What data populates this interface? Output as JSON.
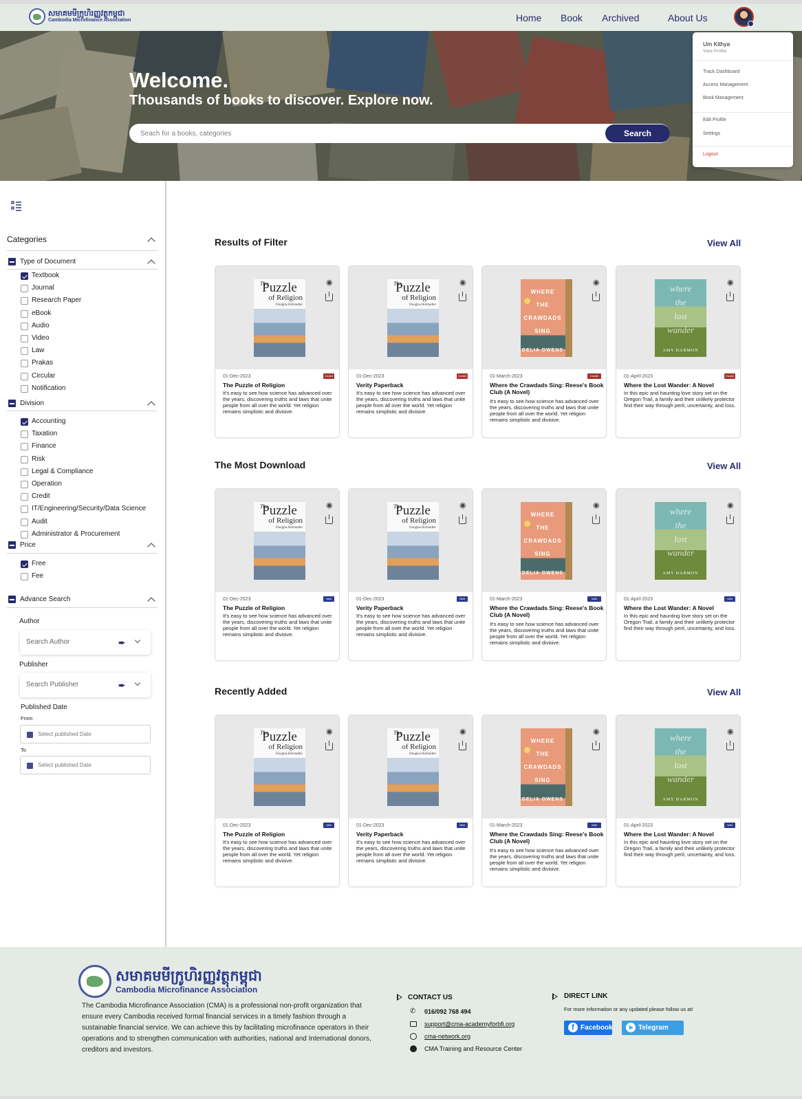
{
  "nav": {
    "logo_khmer": "សមាគមមីក្រូហិរញ្ញវត្ថុកម្ពុជា",
    "logo_english": "Cambodia Microfinance Association",
    "links": [
      "Home",
      "Book",
      "Archived",
      "About Us"
    ]
  },
  "hero": {
    "welcome": "Welcome.",
    "subtitle": "Thousands of books to discover. Explore now.",
    "search_placeholder": "Seach for a books, categories",
    "search_button": "Search"
  },
  "user_menu": {
    "name": "Um Kithya",
    "view_profile": "View Profile",
    "items1": [
      "Track Dashboard",
      "Access Management",
      "Book Management"
    ],
    "items2": [
      "Edit Profile",
      "Settings"
    ],
    "logout": "Logout"
  },
  "sidebar": {
    "categories_title": "Categories",
    "type_group": "Type of Document",
    "type_items": [
      {
        "label": "Textbook",
        "checked": true
      },
      {
        "label": "Journal",
        "checked": false
      },
      {
        "label": "Research Paper",
        "checked": false
      },
      {
        "label": "eBook",
        "checked": false
      },
      {
        "label": "Audio",
        "checked": false
      },
      {
        "label": "Video",
        "checked": false
      },
      {
        "label": "Law",
        "checked": false
      },
      {
        "label": "Prakas",
        "checked": false
      },
      {
        "label": "Circular",
        "checked": false
      },
      {
        "label": "Notification",
        "checked": false
      }
    ],
    "division_group": "Division",
    "division_items": [
      {
        "label": "Accounting",
        "checked": true
      },
      {
        "label": "Taxation",
        "checked": false
      },
      {
        "label": "Finance",
        "checked": false
      },
      {
        "label": "Risk",
        "checked": false
      },
      {
        "label": "Legal & Compliance",
        "checked": false
      },
      {
        "label": "Operation",
        "checked": false
      },
      {
        "label": "Credit",
        "checked": false
      },
      {
        "label": "IT/Engineering/Security/Data Science",
        "checked": false
      },
      {
        "label": "Audit",
        "checked": false
      },
      {
        "label": "Administrator & Procurement",
        "checked": false
      }
    ],
    "price_group": "Price",
    "price_items": [
      {
        "label": "Free",
        "checked": true
      },
      {
        "label": "Fee",
        "checked": false
      }
    ],
    "advance_group": "Advance Search",
    "author_label": "Author",
    "author_placeholder": "Search Author",
    "publisher_label": "Publisher",
    "publisher_placeholder": "Search Publisher",
    "published_date_label": "Published Date",
    "from_label": "From",
    "to_label": "To",
    "date_placeholder": "Select published Date"
  },
  "sections": [
    {
      "title": "Results of Filter",
      "view_all": "View All",
      "badge_color": "#a8322d",
      "badge_text": "Invalid"
    },
    {
      "title": "The Most Download",
      "view_all": "View All",
      "badge_color": "#2b3a8c",
      "badge_text": "Valid"
    },
    {
      "title": "Recently Added",
      "view_all": "View All",
      "badge_color": "#2b3a8c",
      "badge_text": "Valid"
    }
  ],
  "books": [
    {
      "date": "01-Dec-2023",
      "title": "The Puzzle of Religion",
      "desc": "It's easy to see how science has advanced over the years, discovering truths and laws that unite people from all over the world. Yet religion remains simplistic and divisive.",
      "cover": "puzzle"
    },
    {
      "date": "01-Dec-2023",
      "title": "Verity Paperback",
      "desc": "It's easy to see how science has advanced over the years, discovering truths and laws that unite people from all over the world. Yet religion remains simplistic and divisive.",
      "cover": "puzzle"
    },
    {
      "date": "01-March-2023",
      "title": "Where the Crawdads Sing: Reese's Book Club (A Novel)",
      "desc": "It's easy to see how science has advanced over the years, discovering truths and laws that unite people from all over the world. Yet religion remains simplistic and divisive.",
      "cover": "crawdads"
    },
    {
      "date": "01-April-2023",
      "title": "Where the Lost Wander: A Novel",
      "desc": "In this epic and haunting love story set on the Oregon Trail, a family and their unlikely protector find their way through peril, uncertainty, and loss.",
      "cover": "wander"
    }
  ],
  "covers": {
    "puzzle": {
      "the": "The",
      "word1": "Puzzle",
      "word2": "of Religion",
      "author": "Douglas Hofstadter"
    },
    "crawdads": {
      "lines": [
        "WHERE",
        "THE",
        "CRAWDADS",
        "SING"
      ],
      "author": "DELIA OWENS"
    },
    "wander": {
      "lines": [
        "where",
        "the",
        "lost",
        "wander"
      ],
      "author": "AMY HARMON"
    }
  },
  "footer": {
    "logo_khmer": "សមាគមមីក្រូហិរញ្ញវត្ថុកម្ពុជា",
    "logo_english": "Cambodia Microfinance Association",
    "description": "The Cambodia Microfinance Association (CMA) is a professional non-profit organization that ensure every Cambodia received formal financial services in a timely fashion through a sustainable financial service. We can achieve this by facilitating microfinance operators in their operations and to strengthen communication with authorities, national and International donors, creditors and investors.",
    "contact_title": "CONTACT US",
    "phone": "016/092 768 494",
    "email": "support@cma-academyforbfi.org",
    "website": "cma-network.org",
    "center": "CMA Training and Resource Center",
    "direct_title": "DIRECT LINK",
    "direct_text": "For more information or any updated please follow us at!",
    "facebook": "Facebook",
    "telegram": "Telegram"
  },
  "colors": {
    "primary": "#262b6b",
    "nav_bg": "#e4ebe4",
    "logout": "#d9302f"
  }
}
